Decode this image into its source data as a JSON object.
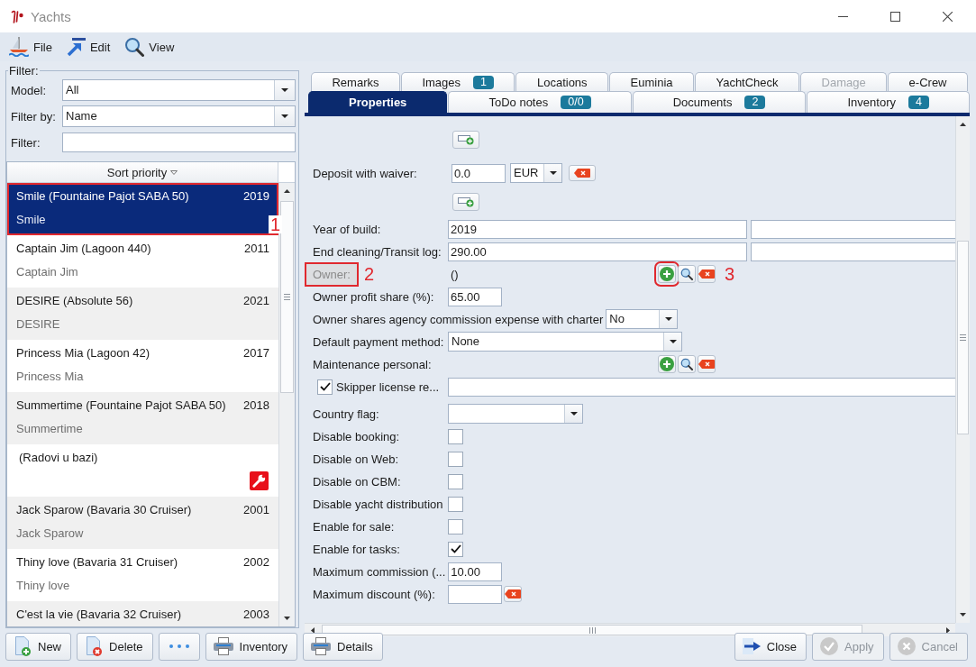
{
  "window": {
    "title": "Yachts"
  },
  "menu": [
    {
      "label": "File"
    },
    {
      "label": "Edit"
    },
    {
      "label": "View"
    }
  ],
  "filter": {
    "title": "Filter:",
    "fields": [
      {
        "kind": "combo",
        "label": "Model:",
        "value": "All"
      },
      {
        "kind": "combo",
        "label": "Filter by:",
        "value": "Name"
      },
      {
        "kind": "text",
        "label": "Filter:"
      }
    ]
  },
  "yacht_list": {
    "header": "Sort priority",
    "items": [
      {
        "kind": "yacht",
        "title": "Smile (Fountaine Pajot SABA 50)",
        "year": "2019",
        "subtitle": "Smile",
        "selected": true,
        "callout": "1"
      },
      {
        "kind": "yacht",
        "title": "Captain Jim (Lagoon 440)",
        "year": "2011",
        "subtitle": "Captain Jim",
        "selected": false
      },
      {
        "kind": "yacht",
        "title": "DESIRE (Absolute 56)",
        "year": "2021",
        "subtitle": "DESIRE",
        "selected": false
      },
      {
        "kind": "yacht",
        "title": "Princess Mia (Lagoon 42)",
        "year": "2017",
        "subtitle": "Princess Mia",
        "selected": false
      },
      {
        "kind": "yacht",
        "title": "Summertime (Fountaine Pajot SABA 50)",
        "year": "2018",
        "subtitle": "Summertime",
        "selected": false
      },
      {
        "kind": "service",
        "title": "(Radovi u bazi)",
        "selected": false
      },
      {
        "kind": "yacht",
        "title": "Jack Sparow (Bavaria 30 Cruiser)",
        "year": "2001",
        "subtitle": "Jack Sparow",
        "selected": false
      },
      {
        "kind": "yacht",
        "title": "Thiny love (Bavaria 31 Cruiser)",
        "year": "2002",
        "subtitle": "Thiny love",
        "selected": false
      },
      {
        "kind": "yacht",
        "title": "C'est la vie (Bavaria 32 Cruiser)",
        "year": "2003",
        "selected": false
      }
    ]
  },
  "tab_rows": [
    {
      "tabs": [
        {
          "label": "Remarks",
          "selected": false,
          "disabled": false
        },
        {
          "label": "Images",
          "badge": "1",
          "selected": false,
          "disabled": false
        },
        {
          "label": "Locations",
          "selected": false,
          "disabled": false
        },
        {
          "label": "Euminia",
          "selected": false,
          "disabled": false
        },
        {
          "label": "YachtCheck",
          "selected": false,
          "disabled": false
        },
        {
          "label": "Damage",
          "selected": false,
          "disabled": true
        },
        {
          "label": "e-Crew",
          "selected": false,
          "disabled": false
        }
      ]
    },
    {
      "tabs": [
        {
          "label": "Properties",
          "selected": true,
          "disabled": false
        },
        {
          "label": "ToDo notes",
          "badge": "0/0",
          "selected": false,
          "disabled": false
        },
        {
          "label": "Documents",
          "badge": "2",
          "selected": false,
          "disabled": false
        },
        {
          "label": "Inventory",
          "badge": "4",
          "selected": false,
          "disabled": false
        }
      ]
    }
  ],
  "properties": {
    "rows": [
      {
        "kind": "add_row"
      },
      {
        "kind": "money",
        "label": "Deposit with waiver:",
        "value": "0.0",
        "currency": "EUR"
      },
      {
        "kind": "add_row"
      },
      {
        "kind": "text_pair",
        "label": "Year of build:",
        "value": "2019"
      },
      {
        "kind": "text_pair",
        "label": "End cleaning/Transit log:",
        "value": "290.00"
      },
      {
        "kind": "person",
        "label": "Owner:",
        "value": "()",
        "disabled": true,
        "callout": "2",
        "add_callout": "3"
      },
      {
        "kind": "short_text",
        "label": "Owner profit share (%):",
        "value": "65.00"
      },
      {
        "kind": "combo",
        "label": "Owner shares agency commission expense with charter",
        "value": "No"
      },
      {
        "kind": "combo",
        "label": "Default payment method:",
        "value": "None"
      },
      {
        "kind": "person",
        "label": "Maintenance personal:",
        "disabled": false
      },
      {
        "kind": "check_text",
        "label": "Skipper license re...",
        "checked": true
      },
      {
        "kind": "combo",
        "label": "Country flag:"
      },
      {
        "kind": "check",
        "label": "Disable booking:",
        "checked": false
      },
      {
        "kind": "check",
        "label": "Disable on Web:",
        "checked": false
      },
      {
        "kind": "check",
        "label": "Disable on CBM:",
        "checked": false
      },
      {
        "kind": "check",
        "label": "Disable yacht distribution",
        "checked": false
      },
      {
        "kind": "check",
        "label": "Enable for sale:",
        "checked": false
      },
      {
        "kind": "check",
        "label": "Enable for tasks:",
        "checked": true
      },
      {
        "kind": "short_text",
        "label": "Maximum commission (...",
        "value": "10.00"
      },
      {
        "kind": "short_text",
        "label": "Maximum discount (%):",
        "clearable": true
      }
    ]
  },
  "actions": {
    "left": [
      {
        "kind": "new",
        "label": "New",
        "disabled": false
      },
      {
        "kind": "delete",
        "label": "Delete",
        "disabled": false
      },
      {
        "kind": "more",
        "disabled": false
      },
      {
        "kind": "print",
        "label": "Inventory",
        "disabled": false
      },
      {
        "kind": "print",
        "label": "Details",
        "disabled": false
      }
    ],
    "right": [
      {
        "kind": "close",
        "label": "Close",
        "disabled": false
      },
      {
        "kind": "apply",
        "label": "Apply",
        "disabled": true
      },
      {
        "kind": "cancel",
        "label": "Cancel",
        "disabled": true
      }
    ]
  }
}
